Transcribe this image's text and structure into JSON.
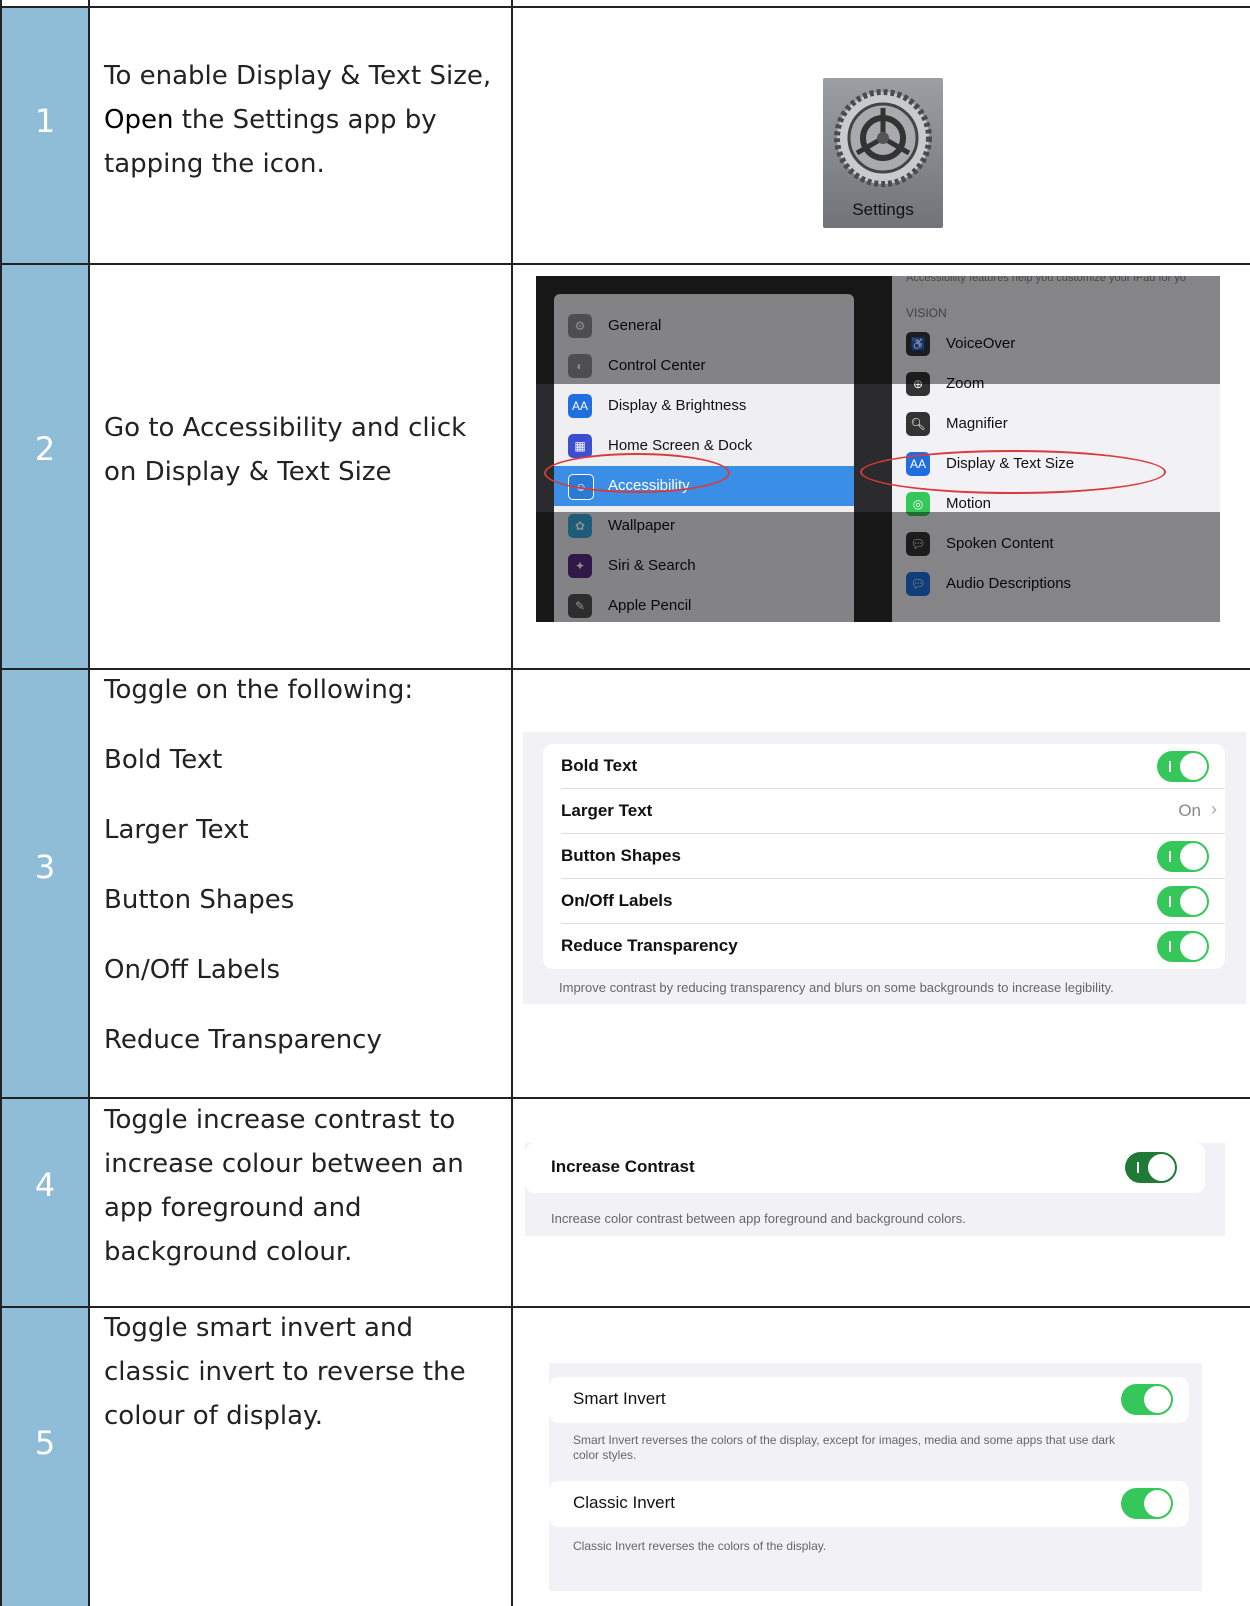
{
  "steps": [
    {
      "num": "1",
      "text_pre": "To enable Display & Text Size,",
      "text_emph": "Open",
      "text_post": " the Settings app by tapping the icon."
    },
    {
      "num": "2",
      "text": "Go to Accessibility and click on Display & Text Size"
    },
    {
      "num": "3",
      "intro": "Toggle on the following:",
      "items": [
        "Bold Text",
        "Larger Text",
        "Button Shapes",
        "On/Off Labels",
        "Reduce Transparency"
      ]
    },
    {
      "num": "4",
      "text": "Toggle increase contrast to increase colour between an app foreground and background colour."
    },
    {
      "num": "5",
      "text": "Toggle smart invert and classic invert to reverse the colour of display."
    }
  ],
  "settings_icon": {
    "label": "Settings"
  },
  "screenshot2": {
    "left_items": [
      "General",
      "Control Center",
      "Display & Brightness",
      "Home Screen & Dock",
      "Accessibility",
      "Wallpaper",
      "Siri & Search",
      "Apple Pencil"
    ],
    "right_caption": "Accessibility features help you customize your iPad for yo",
    "right_header": "VISION",
    "right_items": [
      "VoiceOver",
      "Zoom",
      "Magnifier",
      "Display & Text Size",
      "Motion",
      "Spoken Content",
      "Audio Descriptions"
    ]
  },
  "screenshot3": {
    "rows": [
      {
        "label": "Bold Text",
        "control": "toggle"
      },
      {
        "label": "Larger Text",
        "control": "value",
        "value": "On"
      },
      {
        "label": "Button Shapes",
        "control": "toggle"
      },
      {
        "label": "On/Off Labels",
        "control": "toggle"
      },
      {
        "label": "Reduce Transparency",
        "control": "toggle"
      }
    ],
    "footer": "Improve contrast by reducing transparency and blurs on some backgrounds to increase legibility."
  },
  "screenshot4": {
    "label": "Increase Contrast",
    "footer": "Increase color contrast between app foreground and background colors."
  },
  "screenshot5": {
    "smart_label": "Smart Invert",
    "smart_footer_1": "Smart Invert reverses the colors of the display, except for images, media and some apps that use dark",
    "smart_footer_2": "color styles.",
    "classic_label": "Classic Invert",
    "classic_footer": "Classic Invert reverses the colors of the display."
  },
  "colors": {
    "number_column": "#8fbcd6",
    "toggle_on": "#35c759",
    "selected_row": "#3a8ee6",
    "annotation": "#d93b3b"
  }
}
